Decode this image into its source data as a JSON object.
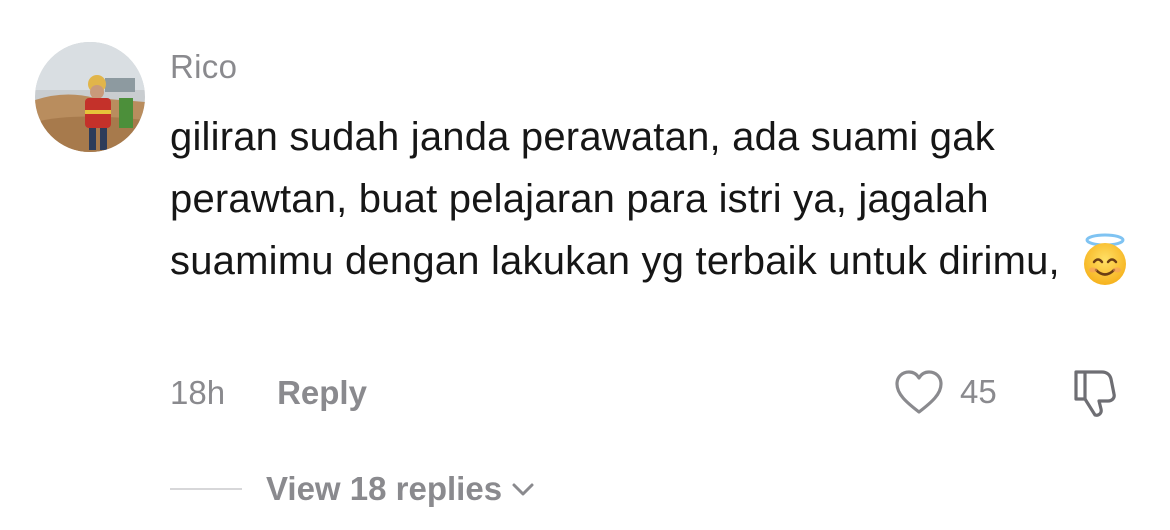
{
  "comment": {
    "username": "Rico",
    "text": "giliran sudah janda perawatan, ada suami gak perawtan, buat pelajaran para istri ya, jagalah suamimu dengan lakukan yg terbaik untuk dirimu,",
    "emoji": "smiling-face-with-halo",
    "timestamp": "18h",
    "reply_label": "Reply",
    "like_count": "45",
    "view_replies_label": "View 18 replies"
  },
  "icons": {
    "like": "heart-outline-icon",
    "dislike": "thumbs-down-outline-icon",
    "expand": "chevron-down-icon"
  },
  "colors": {
    "muted_text": "#8a8a8e",
    "body_text": "#161616",
    "divider": "#d7d7d9"
  }
}
